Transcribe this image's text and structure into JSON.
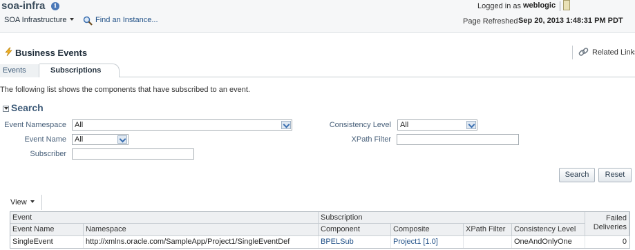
{
  "header": {
    "app_title": "soa-infra",
    "info_icon": "info-icon",
    "soa_menu_label": "SOA Infrastructure",
    "find_instance_label": "Find an Instance...",
    "logged_in_label": "Logged in as",
    "logged_in_user": "weblogic",
    "page_refreshed_label": "Page Refreshed",
    "page_refreshed_value": "Sep 20, 2013 1:48:31 PM PDT"
  },
  "page": {
    "title": "Business Events",
    "related_links": "Related Links"
  },
  "tabs": [
    {
      "label": "Events",
      "selected": false
    },
    {
      "label": "Subscriptions",
      "selected": true
    }
  ],
  "intro_text": "The following list shows the components that have subscribed to an event.",
  "search": {
    "title": "Search",
    "event_namespace_label": "Event Namespace",
    "event_namespace_value": "All",
    "event_name_label": "Event Name",
    "event_name_value": "All",
    "subscriber_label": "Subscriber",
    "subscriber_value": "",
    "consistency_level_label": "Consistency Level",
    "consistency_level_value": "All",
    "xpath_filter_label": "XPath Filter",
    "xpath_filter_value": "",
    "search_button": "Search",
    "reset_button": "Reset"
  },
  "toolbar": {
    "view_label": "View"
  },
  "table": {
    "group_headers": {
      "event": "Event",
      "subscription": "Subscription"
    },
    "columns": {
      "event_name": "Event Name",
      "namespace": "Namespace",
      "component": "Component",
      "composite": "Composite",
      "xpath_filter": "XPath Filter",
      "consistency_level": "Consistency Level",
      "failed_deliveries_line1": "Failed",
      "failed_deliveries_line2": "Deliveries"
    },
    "rows": [
      {
        "event_name": "SingleEvent",
        "namespace": "http://xmlns.oracle.com/SampleApp/Project1/SingleEventDef",
        "component": "BPELSub",
        "composite": "Project1 [1.0]",
        "xpath_filter": "",
        "consistency_level": "OneAndOnlyOne",
        "failed_deliveries": "0"
      }
    ]
  },
  "colors": {
    "link": "#1f4f86",
    "label": "#48607a",
    "header_bg": "#eef0f2"
  }
}
